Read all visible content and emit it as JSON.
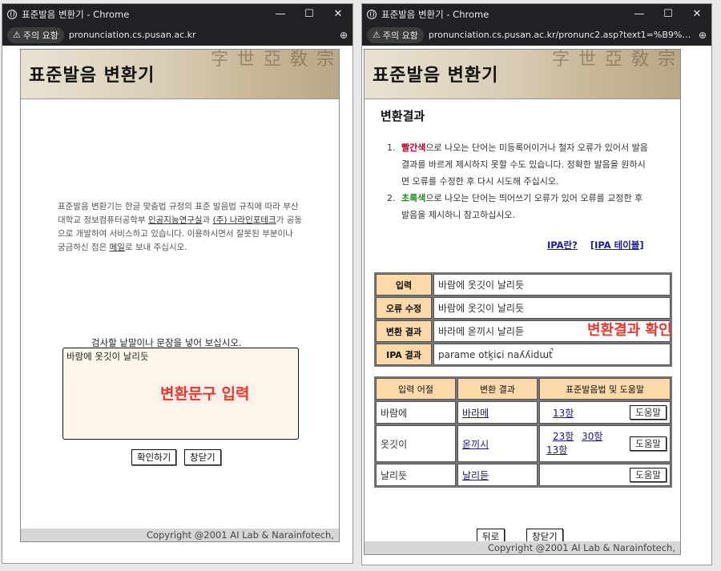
{
  "left": {
    "window_title": "표준발음 변환기 - Chrome",
    "warning_chip": "주의 요함",
    "url": "pronunciation.cs.pusan.ac.kr",
    "banner_title": "표준발음 변환기",
    "banner_deco": "字 世 亞 敎 宗",
    "intro_parts": {
      "p1": "표준발음 변환기는 한글 맞춤법 규정의 표준 발음법 규칙에 따라 부산대학교 정보컴퓨터공학부 ",
      "link1": "인공지능연구실",
      "p2": "과 ",
      "link2": "(주) 나라인포테크",
      "p3": "가 공동으로 개발하여 서비스하고 있습니다. 이용하시면서 잘못된 부분이나 궁금하신 점은 ",
      "link3": "메일",
      "p4": "로 보내 주십시오."
    },
    "prompt": "검사할 낱말이나 문장을 넣어 보십시오.",
    "input_value": "바람에 옷깃이 날리듯",
    "overlay_label": "변환문구 입력",
    "confirm_button": "확인하기",
    "close_button": "창닫기",
    "copyright": "Copyright @2001 AI Lab & Narainfotech,"
  },
  "right": {
    "window_title": "표준발음 변환기 - Chrome",
    "warning_chip": "주의 요함",
    "url": "pronunciation.cs.pusan.ac.kr/pronunc2.asp?text1=%B9%D9%B6%F...",
    "banner_title": "표준발음 변환기",
    "banner_deco": "字 世 亞 敎 宗",
    "result_heading": "변환결과",
    "note1": {
      "num": "1.",
      "color_word": "빨간색",
      "rest": "으로 나오는 단어는 미등록어이거나 철자 오류가 있어서 발음 결과를 바르게 제시하지 못할 수도 있습니다. 정확한 발음을 원하시면 오류를 수정한 후 다시 시도해 주십시오."
    },
    "note2": {
      "num": "2.",
      "color_word": "초록색",
      "rest": "으로 나오는 단어는 띄어쓰기 오류가 있어 오류를 교정한 후 발음을 제시하니 참고하십시오."
    },
    "ipa_link1": "IPA란?",
    "ipa_link2": "[IPA 테이블]",
    "summary": {
      "input_label": "입력",
      "input_value": "바람에 옷깃이 날리듯",
      "fix_label": "오류 수정",
      "fix_value": "바람에 옷깃이 날리듯",
      "conv_label": "변환 결과",
      "conv_value": "바라메 옫끼시 날리듣",
      "ipa_label": "IPA 결과",
      "ipa_value": "parame otk͈iɕi naʎʎidɯt̚"
    },
    "overlay_label": "변환결과 확인",
    "detail_headers": [
      "입력 어절",
      "변환 결과",
      "표준발음법 및 도움말"
    ],
    "rows": [
      {
        "word": "바람에",
        "result": "바라메",
        "rules": [
          "13항"
        ],
        "help": "도움말"
      },
      {
        "word": "옷깃이",
        "result": "옫끼시",
        "rules": [
          "23항",
          "30항",
          "13항"
        ],
        "help": "도움말"
      },
      {
        "word": "날리듯",
        "result": "날리듣",
        "rules": [],
        "help": "도움말"
      }
    ],
    "back_button": "뒤로",
    "close_button": "창닫기",
    "copyright": "Copyright @2001 AI Lab & Narainfotech,"
  },
  "colors": {
    "highlight_red": "#e6392d",
    "warning_red": "#c00020",
    "warning_green": "#1e8a1e",
    "table_header": "#fbd9a9"
  }
}
